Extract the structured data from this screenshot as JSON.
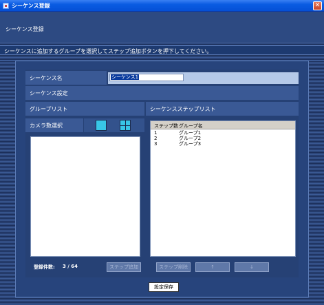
{
  "window": {
    "title": "シーケンス登録",
    "close": "✕"
  },
  "header": {
    "label": "シーケンス登録"
  },
  "instruction": "シーケンスに追加するグループを選択してステップ追加ボタンを押下してください。",
  "form": {
    "sequence_name_label": "シーケンス名",
    "sequence_name_value": "シーケンス1",
    "sequence_settings_label": "シーケンス設定",
    "group_list_label": "グループリスト",
    "step_list_label": "シーケンスステップリスト",
    "camera_count_label": "カメラ数選択"
  },
  "step_list": {
    "columns": [
      "ステップ数",
      "グループ名"
    ],
    "rows": [
      {
        "step": "1",
        "group": "グループ1"
      },
      {
        "step": "2",
        "group": "グループ2"
      },
      {
        "step": "3",
        "group": "グループ3"
      }
    ]
  },
  "registered": {
    "label": "登録件数:",
    "value": "3 / 64"
  },
  "buttons": {
    "add_step": "ステップ追加",
    "delete_step": "ステップ削除",
    "up": "↑",
    "down": "↓",
    "save": "設定保存"
  },
  "colors": {
    "background": "#1f3158",
    "panel": "#27447c",
    "row": "#3a5995",
    "accent": "#38c6e6"
  },
  "icons": {
    "single_view": "square-icon",
    "quad_view": "grid-2x2-icon"
  }
}
